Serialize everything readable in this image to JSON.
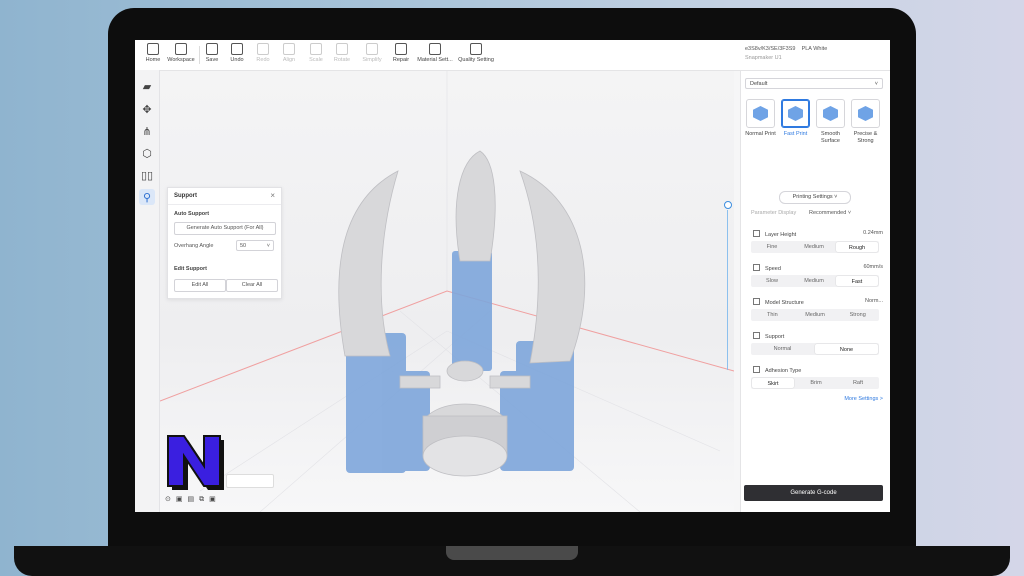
{
  "toolbar": {
    "items": [
      "Home",
      "Workspace",
      "Save",
      "Undo",
      "Redo",
      "Align",
      "Scale",
      "Rotate",
      "Simplify",
      "Repair",
      "Material Sett...",
      "Quality Setting"
    ]
  },
  "printer": {
    "line1": "e3S8v/K3/SE/3F3S9",
    "line2": "Snapmaker U1",
    "material": "PLA White"
  },
  "support_panel": {
    "title": "Support",
    "auto_heading": "Auto Support",
    "generate_btn": "Generate Auto Support (For All)",
    "overhang_label": "Overhang Angle",
    "overhang_value": "50",
    "edit_heading": "Edit Support",
    "edit_all": "Edit All",
    "clear_all": "Clear All"
  },
  "right_panel": {
    "profile": "Default",
    "presets": [
      {
        "label": "Normal Print",
        "selected": false
      },
      {
        "label": "Fast Print",
        "selected": true
      },
      {
        "label": "Smooth Surface",
        "selected": false
      },
      {
        "label": "Precise & Strong",
        "selected": false
      }
    ],
    "printing_settings_btn": "Printing Settings",
    "param_display_label": "Parameter Display",
    "param_display_value": "Recommended",
    "layer_height": {
      "label": "Layer Height",
      "value": "0.24mm",
      "options": [
        "Fine",
        "Medium",
        "Rough"
      ],
      "selected": 2
    },
    "speed": {
      "label": "Speed",
      "value": "60mm/s",
      "options": [
        "Slow",
        "Medium",
        "Fast"
      ],
      "selected": 2
    },
    "model_structure": {
      "label": "Model Structure",
      "value": "Norm...",
      "options": [
        "Thin",
        "Medium",
        "Strong"
      ],
      "selected": -1
    },
    "support": {
      "label": "Support",
      "options": [
        "Normal",
        "None"
      ],
      "selected": 1
    },
    "adhesion": {
      "label": "Adhesion Type",
      "options": [
        "Skirt",
        "Brim",
        "Raft"
      ],
      "selected": 0
    },
    "more_settings": "More Settings >",
    "generate_btn": "Generate G-code"
  },
  "colors": {
    "accent": "#2f7ae0",
    "model_gray": "#d9d9d9",
    "support_blue": "#7ea6db"
  }
}
